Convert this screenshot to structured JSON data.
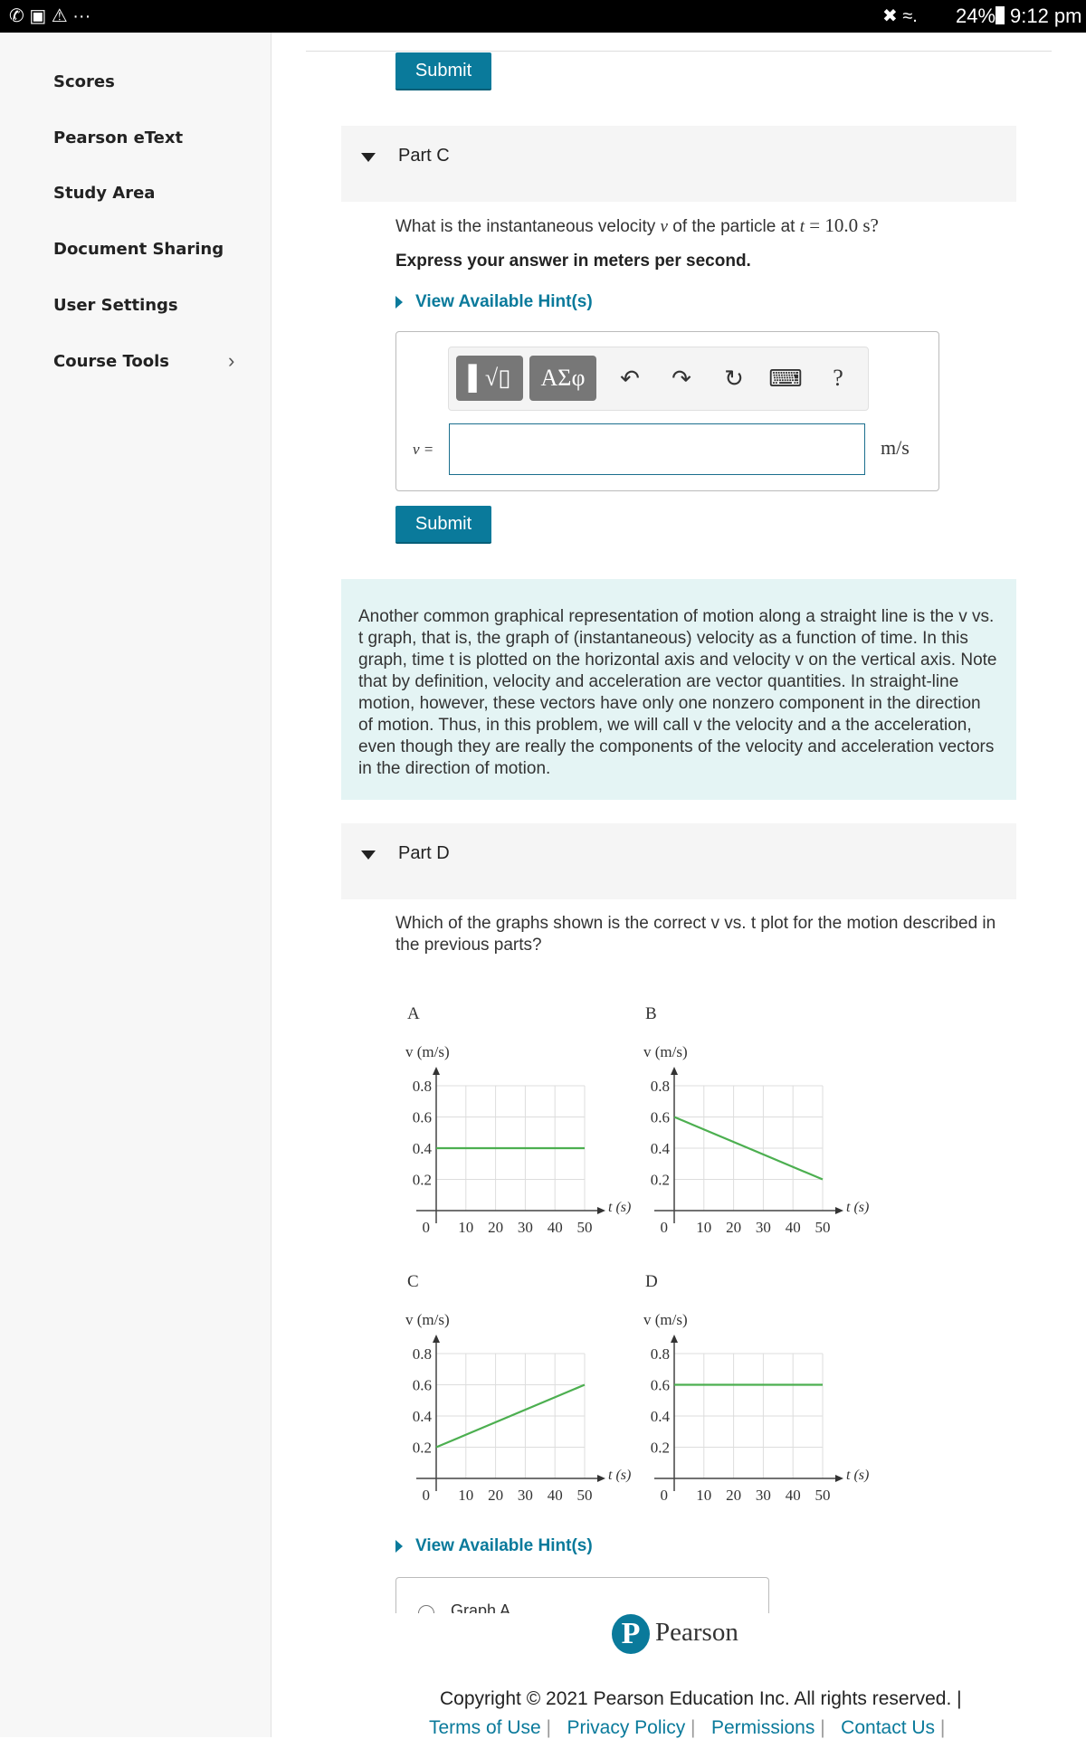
{
  "status_bar": {
    "battery": "24%",
    "time": "9:12 pm"
  },
  "sidebar": {
    "items": [
      {
        "label": "Scores"
      },
      {
        "label": "Pearson eText"
      },
      {
        "label": "Study Area"
      },
      {
        "label": "Document Sharing"
      },
      {
        "label": "User Settings"
      },
      {
        "label": "Course Tools"
      }
    ]
  },
  "submit_label": "Submit",
  "part_c": {
    "title": "Part C",
    "question_pre": "What is the instantaneous velocity ",
    "var_v": "v",
    "question_mid": " of the particle at ",
    "var_t": "t",
    "question_eq": " = 10.0 s?",
    "instruction": "Express your answer in meters per second.",
    "hint": "View Available Hint(s)",
    "toolbar": {
      "templates": "▌√▯",
      "greek": "ΑΣφ",
      "undo": "↶",
      "redo": "↷",
      "reset": "↻",
      "keyboard": "⌨",
      "help": "?"
    },
    "input_label": "v =",
    "input_value": "",
    "unit": "m/s"
  },
  "info_text": "Another common graphical representation of motion along a straight line is the v vs. t graph, that is, the graph of (instantaneous) velocity as a function of time. In this graph, time t is plotted on the horizontal axis and velocity v on the vertical axis. Note that by definition, velocity and acceleration are vector quantities. In straight-line motion, however, these vectors have only one nonzero component in the direction of motion. Thus, in this problem, we will call v the velocity and a the acceleration, even though they are really the components of the velocity and acceleration vectors in the direction of motion.",
  "part_d": {
    "title": "Part D",
    "question": "Which of the graphs shown is the correct v vs. t plot for the motion described in the previous parts?",
    "hint": "View Available Hint(s)",
    "options": [
      "Graph A"
    ]
  },
  "chart_data": [
    {
      "type": "line",
      "title": "A",
      "xlabel": "t (s)",
      "ylabel": "v (m/s)",
      "xticks": [
        0,
        10,
        20,
        30,
        40,
        50
      ],
      "yticks": [
        0.2,
        0.4,
        0.6,
        0.8
      ],
      "xlim": [
        0,
        50
      ],
      "ylim": [
        0,
        0.8
      ],
      "grid": true,
      "x": [
        0,
        50
      ],
      "y": [
        0.4,
        0.4
      ],
      "color": "#4caf50"
    },
    {
      "type": "line",
      "title": "B",
      "xlabel": "t (s)",
      "ylabel": "v (m/s)",
      "xticks": [
        0,
        10,
        20,
        30,
        40,
        50
      ],
      "yticks": [
        0.2,
        0.4,
        0.6,
        0.8
      ],
      "xlim": [
        0,
        50
      ],
      "ylim": [
        0,
        0.8
      ],
      "grid": true,
      "x": [
        0,
        50
      ],
      "y": [
        0.6,
        0.2
      ],
      "color": "#4caf50"
    },
    {
      "type": "line",
      "title": "C",
      "xlabel": "t (s)",
      "ylabel": "v (m/s)",
      "xticks": [
        0,
        10,
        20,
        30,
        40,
        50
      ],
      "yticks": [
        0.2,
        0.4,
        0.6,
        0.8
      ],
      "xlim": [
        0,
        50
      ],
      "ylim": [
        0,
        0.8
      ],
      "grid": true,
      "x": [
        0,
        50
      ],
      "y": [
        0.2,
        0.6
      ],
      "color": "#4caf50"
    },
    {
      "type": "line",
      "title": "D",
      "xlabel": "t (s)",
      "ylabel": "v (m/s)",
      "xticks": [
        0,
        10,
        20,
        30,
        40,
        50
      ],
      "yticks": [
        0.2,
        0.4,
        0.6,
        0.8
      ],
      "xlim": [
        0,
        50
      ],
      "ylim": [
        0,
        0.8
      ],
      "grid": true,
      "x": [
        0,
        50
      ],
      "y": [
        0.6,
        0.6
      ],
      "color": "#4caf50"
    }
  ],
  "footer": {
    "brand": "Pearson",
    "copyright": "Copyright © 2021 Pearson Education Inc. All rights reserved.",
    "links": [
      "Terms of Use",
      "Privacy Policy",
      "Permissions",
      "Contact Us"
    ]
  },
  "colors": {
    "accent": "#0a7a9b",
    "info_bg": "#e4f4f4",
    "series": "#4caf50"
  }
}
